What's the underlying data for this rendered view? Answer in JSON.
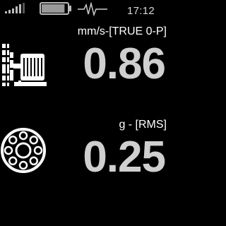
{
  "status_bar": {
    "time": "17:12",
    "icons": [
      "signal-strength-icon",
      "battery-icon",
      "vibration-pulse-icon"
    ],
    "signal_bars": 4,
    "battery_level": 0.9
  },
  "readings": [
    {
      "unit": "mm/s-[TRUE 0-P]",
      "value": "0.86",
      "icon": "machine-icon"
    },
    {
      "unit": "g - [RMS]",
      "value": "0.25",
      "icon": "bearing-icon"
    }
  ],
  "colors": {
    "background": "#000000",
    "value_text": "#cfcfcf",
    "label_text": "#ffffff"
  }
}
